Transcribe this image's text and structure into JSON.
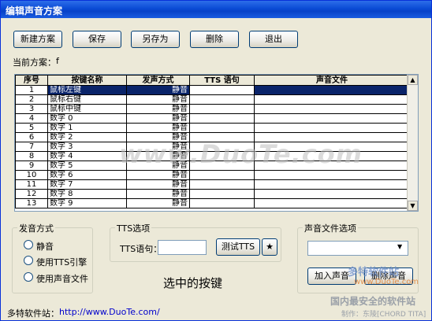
{
  "window": {
    "title": "编辑声音方案"
  },
  "toolbar": {
    "new_label": "新建方案",
    "save_label": "保存",
    "save_as_label": "另存为",
    "delete_label": "删除",
    "exit_label": "退出"
  },
  "current_scheme": {
    "label": "当前方案：",
    "value": "f"
  },
  "grid": {
    "headers": [
      "序号",
      "按键名称",
      "发声方式",
      "TTS 语句",
      "声音文件"
    ],
    "rows": [
      {
        "num": "1",
        "key": "鼠标左键",
        "mode": "静音",
        "tts": "",
        "file": "",
        "selected": true
      },
      {
        "num": "2",
        "key": "鼠标右键",
        "mode": "静音",
        "tts": "",
        "file": ""
      },
      {
        "num": "3",
        "key": "鼠标中键",
        "mode": "静音",
        "tts": "",
        "file": ""
      },
      {
        "num": "4",
        "key": "数字 0",
        "mode": "静音",
        "tts": "",
        "file": ""
      },
      {
        "num": "5",
        "key": "数字 1",
        "mode": "静音",
        "tts": "",
        "file": ""
      },
      {
        "num": "6",
        "key": "数字 2",
        "mode": "静音",
        "tts": "",
        "file": ""
      },
      {
        "num": "7",
        "key": "数字 3",
        "mode": "静音",
        "tts": "",
        "file": ""
      },
      {
        "num": "8",
        "key": "数字 4",
        "mode": "静音",
        "tts": "",
        "file": ""
      },
      {
        "num": "9",
        "key": "数字 5",
        "mode": "静音",
        "tts": "",
        "file": ""
      },
      {
        "num": "10",
        "key": "数字 6",
        "mode": "静音",
        "tts": "",
        "file": ""
      },
      {
        "num": "11",
        "key": "数字 7",
        "mode": "静音",
        "tts": "",
        "file": ""
      },
      {
        "num": "12",
        "key": "数字 8",
        "mode": "静音",
        "tts": "",
        "file": ""
      },
      {
        "num": "13",
        "key": "数字 9",
        "mode": "静音",
        "tts": "",
        "file": ""
      }
    ]
  },
  "sound_mode": {
    "title": "发音方式",
    "options": [
      "静音",
      "使用TTS引擎",
      "使用声音文件"
    ],
    "selected_index": -1
  },
  "tts_options": {
    "title": "TTS选项",
    "input_label": "TTS语句：",
    "input_value": "",
    "test_label": "测试TTS",
    "star_label": "★"
  },
  "selected_key_text": "选中的按键",
  "sound_file_options": {
    "title": "声音文件选项",
    "select_value": "",
    "add_label": "加入声音",
    "remove_label": "删除声音"
  },
  "footer": {
    "site_label": "多特软件站：",
    "site_url": "http://www.DuoTe.com/"
  },
  "watermark": {
    "main": "www.DuoTe.com",
    "brand": "多特软件站",
    "domain": "www.DuoTe.com",
    "slogan": "国内最安全的软件站",
    "credit": "制作：东陵[CHORD TITA]"
  },
  "colors": {
    "title_bar": "#0a4bd5",
    "selection": "#0a246a",
    "link": "#0000cc"
  }
}
